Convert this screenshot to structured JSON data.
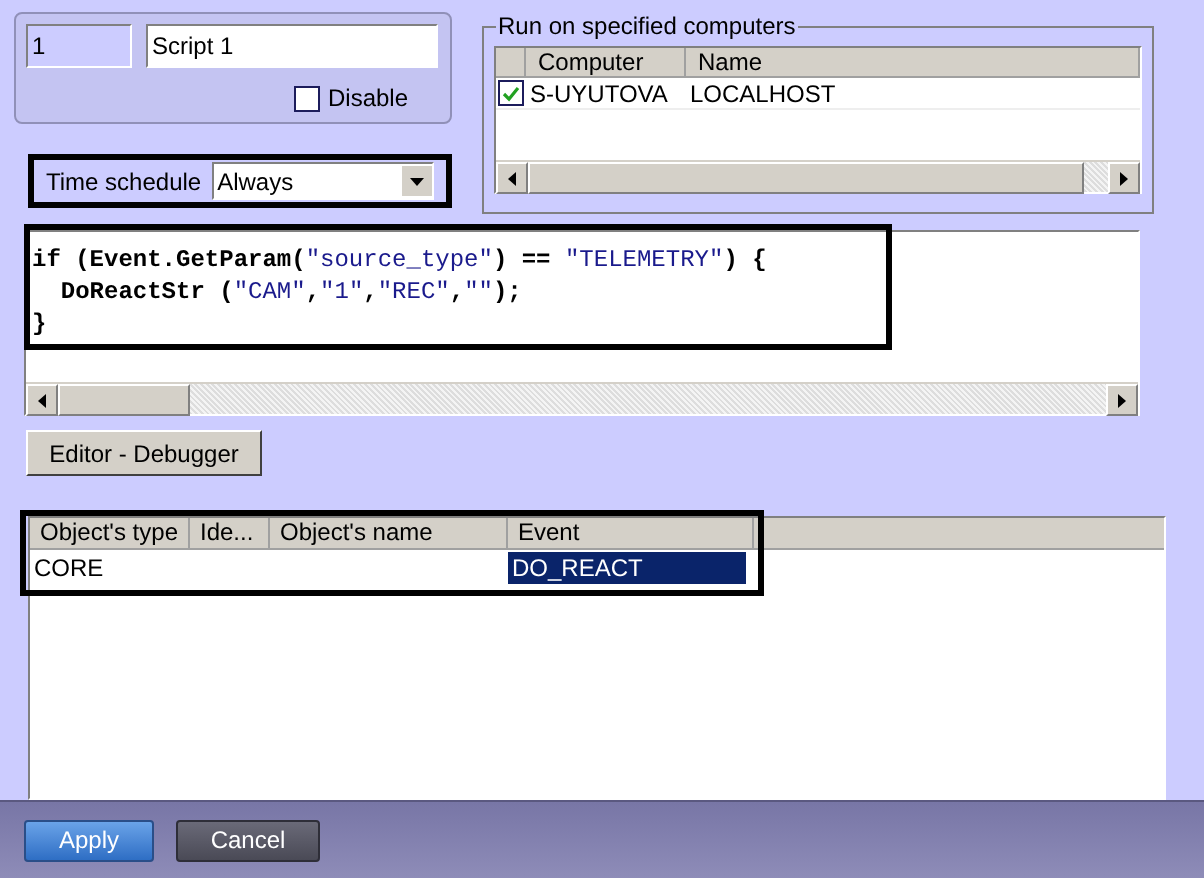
{
  "script": {
    "number": "1",
    "name": "Script 1"
  },
  "disable": {
    "label": "Disable",
    "checked": false
  },
  "time_schedule": {
    "label": "Time schedule",
    "value": "Always"
  },
  "computers": {
    "title": "Run on specified computers",
    "columns": [
      "Computer",
      "Name"
    ],
    "rows": [
      {
        "checked": true,
        "cells": [
          "S-UYUTOVA",
          "LOCALHOST"
        ]
      }
    ]
  },
  "code": [
    [
      {
        "kind": "plain",
        "text": "if (Event.GetParam("
      },
      {
        "kind": "string",
        "text": "\"source_type\""
      },
      {
        "kind": "plain",
        "text": ") == "
      },
      {
        "kind": "string",
        "text": "\"TELEMETRY\""
      },
      {
        "kind": "plain",
        "text": ") {"
      }
    ],
    [
      {
        "kind": "plain",
        "text": "  DoReactStr ("
      },
      {
        "kind": "string",
        "text": "\"CAM\""
      },
      {
        "kind": "plain",
        "text": ","
      },
      {
        "kind": "string",
        "text": "\"1\""
      },
      {
        "kind": "plain",
        "text": ","
      },
      {
        "kind": "string",
        "text": "\"REC\""
      },
      {
        "kind": "plain",
        "text": ","
      },
      {
        "kind": "string",
        "text": "\"\""
      },
      {
        "kind": "plain",
        "text": ");"
      }
    ],
    [
      {
        "kind": "plain",
        "text": "}"
      }
    ]
  ],
  "editor_button": "Editor - Debugger",
  "objects": {
    "columns": [
      "Object's type",
      "Ide...",
      "Object's name",
      "Event"
    ],
    "rows": [
      {
        "cells": [
          {
            "text": "CORE",
            "selected": false
          },
          {
            "text": "",
            "selected": false
          },
          {
            "text": "",
            "selected": false
          },
          {
            "text": "DO_REACT",
            "selected": true
          }
        ]
      }
    ]
  },
  "buttons": [
    {
      "label": "Apply",
      "kind": "primary"
    },
    {
      "label": "Cancel",
      "kind": "secondary"
    }
  ]
}
